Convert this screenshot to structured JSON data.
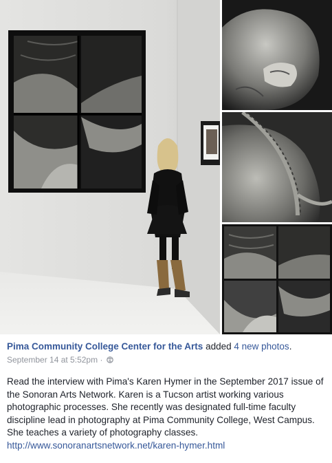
{
  "post": {
    "page_name": "Pima Community College Center for the Arts",
    "added_text": "added",
    "photos_link": "4 new photos",
    "period": ".",
    "timestamp": "September 14 at 5:52pm",
    "separator": "·",
    "privacy_icon": "globe-icon",
    "body": "Read the interview with Pima's Karen Hymer in the September 2017 issue of the Sonoran Arts Network. Karen is a Tucson artist working various photographic processes. She recently was designated full-time faculty discipline lead in photography at Pima Community College, West Campus. She teaches a variety of photography classes.",
    "link": "http://www.sonoranartsnetwork.net/karen-hymer.html"
  },
  "colors": {
    "link_blue": "#365899",
    "text": "#1d2129",
    "meta_grey": "#90949c"
  }
}
